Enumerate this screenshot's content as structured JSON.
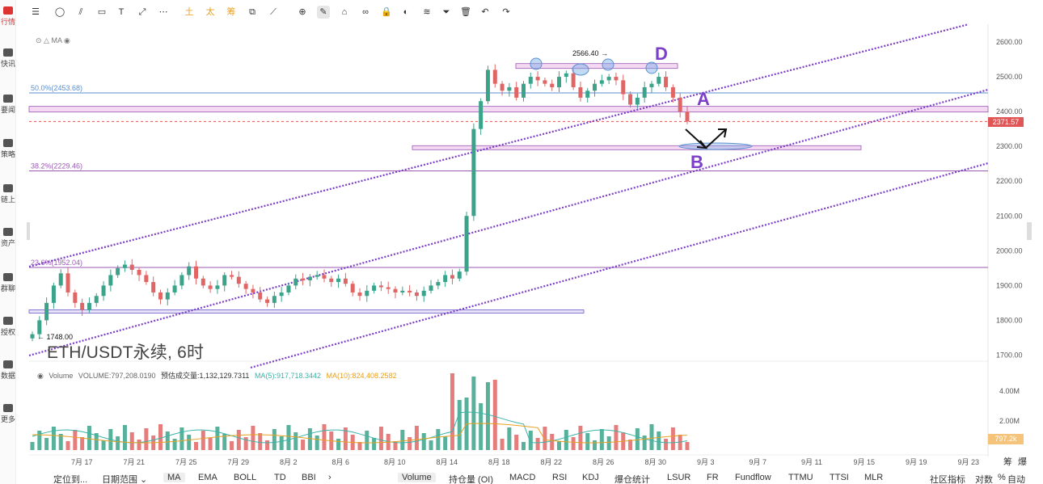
{
  "nav": {
    "items": [
      {
        "label": "行情",
        "active": true
      },
      {
        "label": "快讯"
      },
      {
        "label": "要闻"
      },
      {
        "label": "策略"
      },
      {
        "label": "链上"
      },
      {
        "label": "资产"
      },
      {
        "label": "群聊"
      },
      {
        "label": "授权"
      },
      {
        "label": "数据"
      },
      {
        "label": "更多"
      }
    ]
  },
  "toolbar": {
    "icons": [
      "menu-icon",
      "ellipse-icon",
      "parallel-lines-icon",
      "rectangle-icon",
      "text-icon",
      "arrow-line-icon",
      "more-dots-icon",
      "fib-1-icon",
      "fib-2-icon",
      "fib-3-icon",
      "copy-icon",
      "measure-icon",
      "ruler-icon",
      "pencil-icon",
      "zoom-icon",
      "magnet-icon",
      "lock-icon",
      "eye-icon",
      "layers-icon",
      "filter-icon",
      "trash-icon",
      "undo-icon",
      "redo-icon"
    ],
    "glyphs": [
      "☰",
      "◯",
      "⫽",
      "▭",
      "T",
      "⤢",
      "⋯",
      "土",
      "太",
      "筹",
      "⧉",
      "⟋",
      "⊕",
      "✎",
      "⌂",
      "∞",
      "🔒",
      "◐",
      "≋",
      "⏷",
      "🗑",
      "↶",
      "↷"
    ]
  },
  "ma_legend": {
    "label": "MA"
  },
  "symbol_title": "ETH/USDT永续, 6时",
  "volume_legend": {
    "name": "Volume",
    "volume": "VOLUME:797,208.0190",
    "forecast": "预估成交量:1,132,129.7311",
    "ma5": "MA(5):917,718.3442",
    "ma10": "MA(10):824,408.2582",
    "ma5_color": "#3bb3a8",
    "ma10_color": "#e8a020"
  },
  "annotations": {
    "fib_50": "50.0%(2453.68)",
    "fib_382": "38.2%(2229.46)",
    "fib_236": "23.6%(1952.04)",
    "high_label": "2566.40 →",
    "low_label": "← 1748.00",
    "letter_a": "A",
    "letter_b": "B",
    "letter_d": "D"
  },
  "price_axis": {
    "ticks": [
      "2600.00",
      "2500.00",
      "2400.00",
      "2300.00",
      "2200.00",
      "2100.00",
      "2000.00",
      "1900.00",
      "1800.00",
      "1700.00"
    ],
    "current_price": "2371.57",
    "volume_ticks": [
      "4.00M",
      "2.00M"
    ],
    "current_volume": "797.2k"
  },
  "time_axis": {
    "ticks": [
      "7月 17",
      "7月 21",
      "7月 25",
      "7月 29",
      "8月 2",
      "8月 6",
      "8月 10",
      "8月 14",
      "8月 18",
      "8月 22",
      "8月 26",
      "8月 30",
      "9月 3",
      "9月 7",
      "9月 11",
      "9月 15",
      "9月 19",
      "9月 23"
    ]
  },
  "bottom_bar": {
    "locate": "定位到...",
    "date_range": "日期范围 ⌄",
    "indicators_left": [
      "MA",
      "EMA",
      "BOLL",
      "TD",
      "BBI"
    ],
    "more_arrow": "›",
    "indicators_right": [
      "Volume",
      "持仓量 (OI)",
      "MACD",
      "RSI",
      "KDJ",
      "爆仓统计",
      "LSUR",
      "FR",
      "Fundflow",
      "TTMU",
      "TTSI",
      "MLR"
    ],
    "community": "社区指标",
    "log": "对数",
    "percent": "%",
    "auto": "自动",
    "corner_top": "筹",
    "corner_top2": "爆"
  },
  "colors": {
    "up": "#3aa38a",
    "down": "#e06666",
    "purple": "#7b3fc9",
    "zone_fill": "#f3d9f2",
    "zone_stroke": "#9b59b6"
  },
  "chart_data": {
    "type": "candlestick",
    "x_range": [
      "7月 14",
      "9月 25"
    ],
    "ylim": [
      1650,
      2650
    ],
    "closes": [
      1760,
      1800,
      1850,
      1900,
      1935,
      1880,
      1850,
      1830,
      1850,
      1870,
      1900,
      1930,
      1950,
      1960,
      1945,
      1930,
      1910,
      1880,
      1860,
      1880,
      1900,
      1930,
      1955,
      1920,
      1900,
      1890,
      1900,
      1930,
      1925,
      1905,
      1890,
      1880,
      1860,
      1850,
      1870,
      1880,
      1900,
      1920,
      1915,
      1925,
      1930,
      1920,
      1910,
      1920,
      1905,
      1880,
      1870,
      1885,
      1900,
      1895,
      1890,
      1880,
      1885,
      1880,
      1870,
      1885,
      1900,
      1910,
      1930,
      1920,
      1940,
      2100,
      2350,
      2430,
      2520,
      2480,
      2460,
      2470,
      2440,
      2480,
      2500,
      2490,
      2480,
      2470,
      2500,
      2510,
      2470,
      2440,
      2460,
      2480,
      2490,
      2500,
      2490,
      2450,
      2420,
      2440,
      2470,
      2480,
      2500,
      2470,
      2440,
      2400,
      2371.57
    ],
    "current_price": 2371.57,
    "high": 2566.4,
    "low": 1748.0
  }
}
